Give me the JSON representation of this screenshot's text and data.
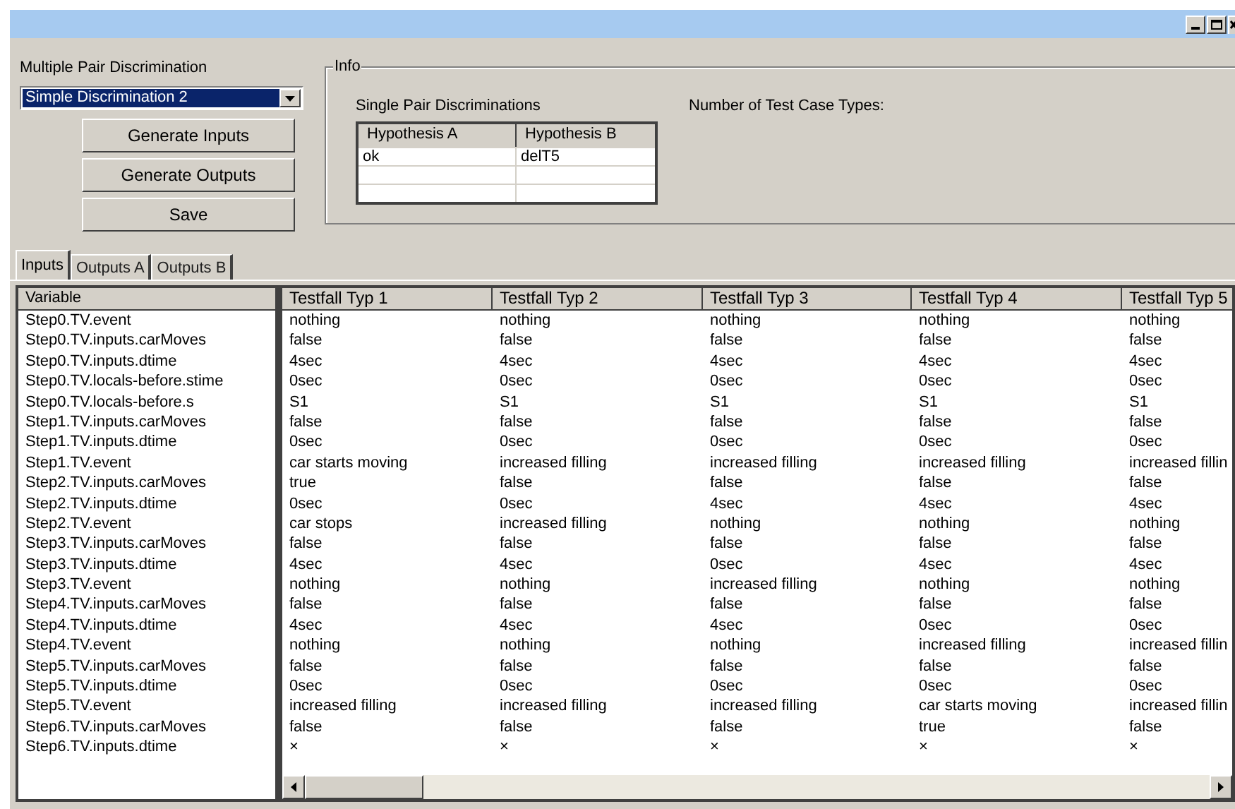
{
  "discrimination": {
    "label": "Multiple Pair Discrimination",
    "value": "Simple Discrimination 2"
  },
  "buttons": [
    "Generate Inputs",
    "Generate Outputs",
    "Save"
  ],
  "info": {
    "title": "Info",
    "pairs_label": "Single Pair Discriminations",
    "columns": [
      "Hypothesis A",
      "Hypothesis B"
    ],
    "rows": [
      [
        "ok",
        "delT5"
      ]
    ],
    "test_case_types_label": "Number of Test Case Types:"
  },
  "tabs": [
    {
      "label": "Inputs",
      "selected": true
    },
    {
      "label": "Outputs A",
      "selected": false
    },
    {
      "label": "Outputs B",
      "selected": false
    }
  ],
  "table": {
    "variable_column": "Variable",
    "columns": [
      "Testfall Typ 1",
      "Testfall Typ 2",
      "Testfall Typ 3",
      "Testfall Typ 4",
      "Testfall Typ 5"
    ],
    "rows": [
      {
        "variable": "Step0.TV.event",
        "values": [
          "nothing",
          "nothing",
          "nothing",
          "nothing",
          "nothing"
        ]
      },
      {
        "variable": "Step0.TV.inputs.carMoves",
        "values": [
          "false",
          "false",
          "false",
          "false",
          "false"
        ]
      },
      {
        "variable": "Step0.TV.inputs.dtime",
        "values": [
          "4sec",
          "4sec",
          "4sec",
          "4sec",
          "4sec"
        ]
      },
      {
        "variable": "Step0.TV.locals-before.stime",
        "values": [
          "0sec",
          "0sec",
          "0sec",
          "0sec",
          "0sec"
        ]
      },
      {
        "variable": "Step0.TV.locals-before.s",
        "values": [
          "S1",
          "S1",
          "S1",
          "S1",
          "S1"
        ]
      },
      {
        "variable": "Step1.TV.inputs.carMoves",
        "values": [
          "false",
          "false",
          "false",
          "false",
          "false"
        ]
      },
      {
        "variable": "Step1.TV.inputs.dtime",
        "values": [
          "0sec",
          "0sec",
          "0sec",
          "0sec",
          "0sec"
        ]
      },
      {
        "variable": "Step1.TV.event",
        "values": [
          "car starts moving",
          "increased filling",
          "increased filling",
          "increased filling",
          "increased fillin"
        ]
      },
      {
        "variable": "Step2.TV.inputs.carMoves",
        "values": [
          "true",
          "false",
          "false",
          "false",
          "false"
        ]
      },
      {
        "variable": "Step2.TV.inputs.dtime",
        "values": [
          "0sec",
          "0sec",
          "4sec",
          "4sec",
          "4sec"
        ]
      },
      {
        "variable": "Step2.TV.event",
        "values": [
          "car stops",
          "increased filling",
          "nothing",
          "nothing",
          "nothing"
        ]
      },
      {
        "variable": "Step3.TV.inputs.carMoves",
        "values": [
          "false",
          "false",
          "false",
          "false",
          "false"
        ]
      },
      {
        "variable": "Step3.TV.inputs.dtime",
        "values": [
          "4sec",
          "4sec",
          "0sec",
          "4sec",
          "4sec"
        ]
      },
      {
        "variable": "Step3.TV.event",
        "values": [
          "nothing",
          "nothing",
          "increased filling",
          "nothing",
          "nothing"
        ]
      },
      {
        "variable": "Step4.TV.inputs.carMoves",
        "values": [
          "false",
          "false",
          "false",
          "false",
          "false"
        ]
      },
      {
        "variable": "Step4.TV.inputs.dtime",
        "values": [
          "4sec",
          "4sec",
          "4sec",
          "0sec",
          "0sec"
        ]
      },
      {
        "variable": "Step4.TV.event",
        "values": [
          "nothing",
          "nothing",
          "nothing",
          "increased filling",
          "increased fillin"
        ]
      },
      {
        "variable": "Step5.TV.inputs.carMoves",
        "values": [
          "false",
          "false",
          "false",
          "false",
          "false"
        ]
      },
      {
        "variable": "Step5.TV.inputs.dtime",
        "values": [
          "0sec",
          "0sec",
          "0sec",
          "0sec",
          "0sec"
        ]
      },
      {
        "variable": "Step5.TV.event",
        "values": [
          "increased filling",
          "increased filling",
          "increased filling",
          "car starts moving",
          "increased fillin"
        ]
      },
      {
        "variable": "Step6.TV.inputs.carMoves",
        "values": [
          "false",
          "false",
          "false",
          "true",
          "false"
        ]
      },
      {
        "variable": "Step6.TV.inputs.dtime",
        "values": [
          "×",
          "×",
          "×",
          "×",
          "×"
        ]
      }
    ]
  }
}
